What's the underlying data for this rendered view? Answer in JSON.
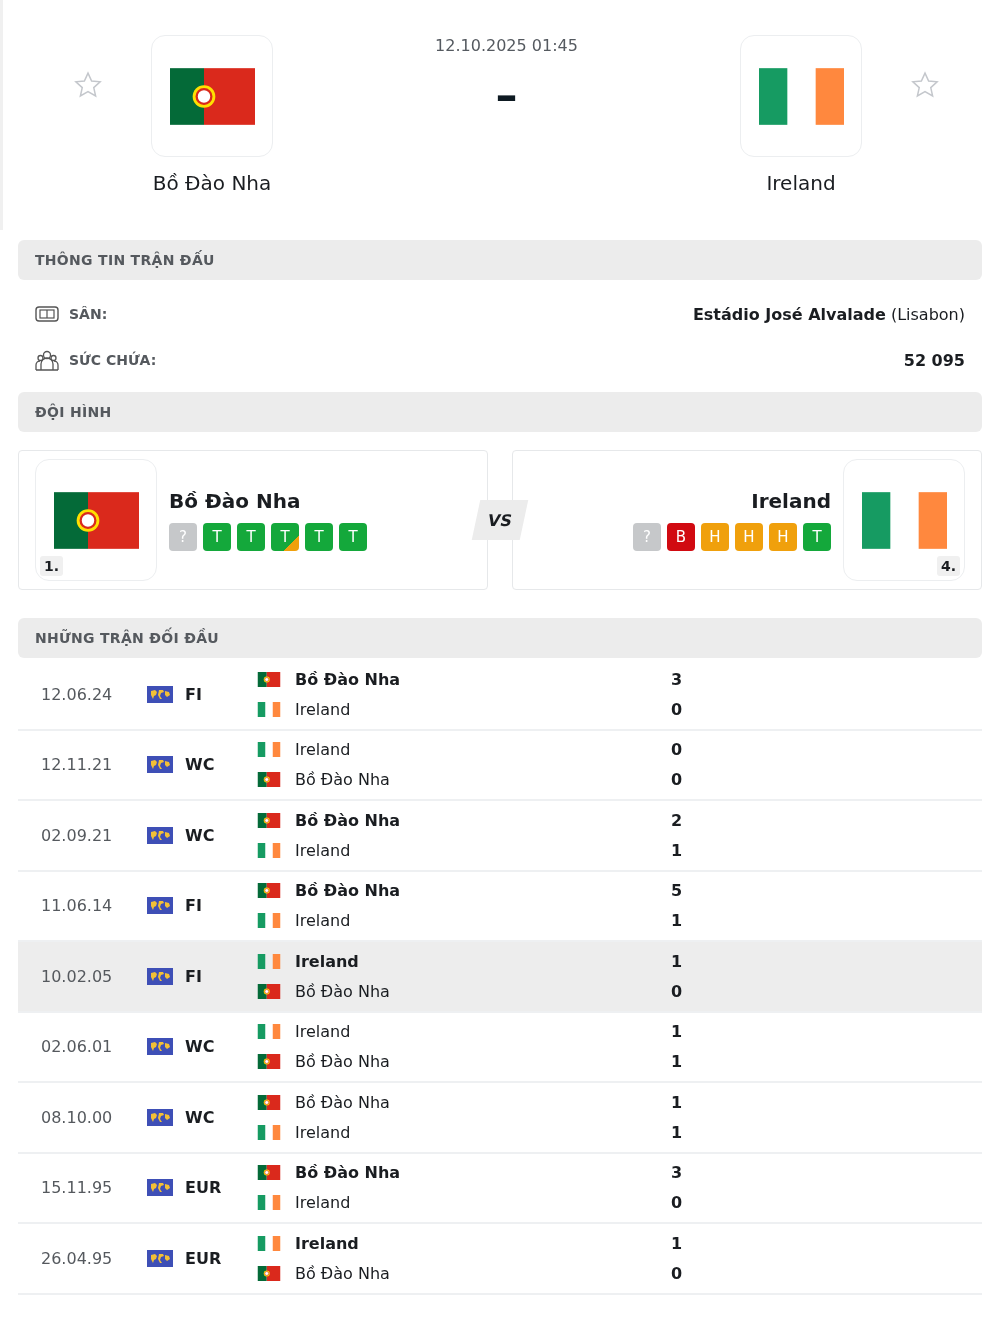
{
  "header": {
    "datetime": "12.10.2025 01:45",
    "score": "–",
    "home": {
      "name": "Bồ Đào Nha",
      "kind": "pt",
      "favorite": false
    },
    "away": {
      "name": "Ireland",
      "kind": "ie",
      "favorite": false
    }
  },
  "match_info": {
    "title": "THÔNG TIN TRẬN ĐẤU",
    "rows": [
      {
        "kind": "stadium",
        "label": "SÂN:",
        "value": "Estádio José Alvalade",
        "extra": "(Lisabon)"
      },
      {
        "kind": "capacity",
        "label": "SỨC CHỨA:",
        "value": "52 095"
      }
    ]
  },
  "lineup": {
    "title": "ĐỘI HÌNH",
    "vs": "VS",
    "teams": [
      {
        "name": "Bồ Đào Nha",
        "kind": "pt",
        "rank": "1.",
        "form": [
          {
            "label": "?",
            "kind": "unknown",
            "corner": false
          },
          {
            "label": "T",
            "kind": "win",
            "corner": false
          },
          {
            "label": "T",
            "kind": "win",
            "corner": false
          },
          {
            "label": "T",
            "kind": "win",
            "corner": true
          },
          {
            "label": "T",
            "kind": "win",
            "corner": false
          },
          {
            "label": "T",
            "kind": "win",
            "corner": false
          }
        ]
      },
      {
        "name": "Ireland",
        "kind": "ie",
        "rank": "4.",
        "form": [
          {
            "label": "?",
            "kind": "unknown",
            "corner": false
          },
          {
            "label": "B",
            "kind": "loss",
            "corner": false
          },
          {
            "label": "H",
            "kind": "draw",
            "corner": false
          },
          {
            "label": "H",
            "kind": "draw",
            "corner": false
          },
          {
            "label": "H",
            "kind": "draw",
            "corner": false
          },
          {
            "label": "T",
            "kind": "win",
            "corner": false
          }
        ]
      }
    ]
  },
  "h2h": {
    "title": "NHỮNG TRẬN ĐỐI ĐẦU",
    "matches": [
      {
        "date": "12.06.24",
        "competition": "FI",
        "selected": false,
        "teams": [
          {
            "name": "Bồ Đào Nha",
            "kind": "pt",
            "score": "3",
            "winner": true
          },
          {
            "name": "Ireland",
            "kind": "ie",
            "score": "0",
            "winner": false
          }
        ]
      },
      {
        "date": "12.11.21",
        "competition": "WC",
        "selected": false,
        "teams": [
          {
            "name": "Ireland",
            "kind": "ie",
            "score": "0",
            "winner": false
          },
          {
            "name": "Bồ Đào Nha",
            "kind": "pt",
            "score": "0",
            "winner": false
          }
        ]
      },
      {
        "date": "02.09.21",
        "competition": "WC",
        "selected": false,
        "teams": [
          {
            "name": "Bồ Đào Nha",
            "kind": "pt",
            "score": "2",
            "winner": true
          },
          {
            "name": "Ireland",
            "kind": "ie",
            "score": "1",
            "winner": false
          }
        ]
      },
      {
        "date": "11.06.14",
        "competition": "FI",
        "selected": false,
        "teams": [
          {
            "name": "Bồ Đào Nha",
            "kind": "pt",
            "score": "5",
            "winner": true
          },
          {
            "name": "Ireland",
            "kind": "ie",
            "score": "1",
            "winner": false
          }
        ]
      },
      {
        "date": "10.02.05",
        "competition": "FI",
        "selected": true,
        "teams": [
          {
            "name": "Ireland",
            "kind": "ie",
            "score": "1",
            "winner": true
          },
          {
            "name": "Bồ Đào Nha",
            "kind": "pt",
            "score": "0",
            "winner": false
          }
        ]
      },
      {
        "date": "02.06.01",
        "competition": "WC",
        "selected": false,
        "teams": [
          {
            "name": "Ireland",
            "kind": "ie",
            "score": "1",
            "winner": false
          },
          {
            "name": "Bồ Đào Nha",
            "kind": "pt",
            "score": "1",
            "winner": false
          }
        ]
      },
      {
        "date": "08.10.00",
        "competition": "WC",
        "selected": false,
        "teams": [
          {
            "name": "Bồ Đào Nha",
            "kind": "pt",
            "score": "1",
            "winner": false
          },
          {
            "name": "Ireland",
            "kind": "ie",
            "score": "1",
            "winner": false
          }
        ]
      },
      {
        "date": "15.11.95",
        "competition": "EUR",
        "selected": false,
        "teams": [
          {
            "name": "Bồ Đào Nha",
            "kind": "pt",
            "score": "3",
            "winner": true
          },
          {
            "name": "Ireland",
            "kind": "ie",
            "score": "0",
            "winner": false
          }
        ]
      },
      {
        "date": "26.04.95",
        "competition": "EUR",
        "selected": false,
        "teams": [
          {
            "name": "Ireland",
            "kind": "ie",
            "score": "1",
            "winner": true
          },
          {
            "name": "Bồ Đào Nha",
            "kind": "pt",
            "score": "0",
            "winner": false
          }
        ]
      }
    ]
  }
}
